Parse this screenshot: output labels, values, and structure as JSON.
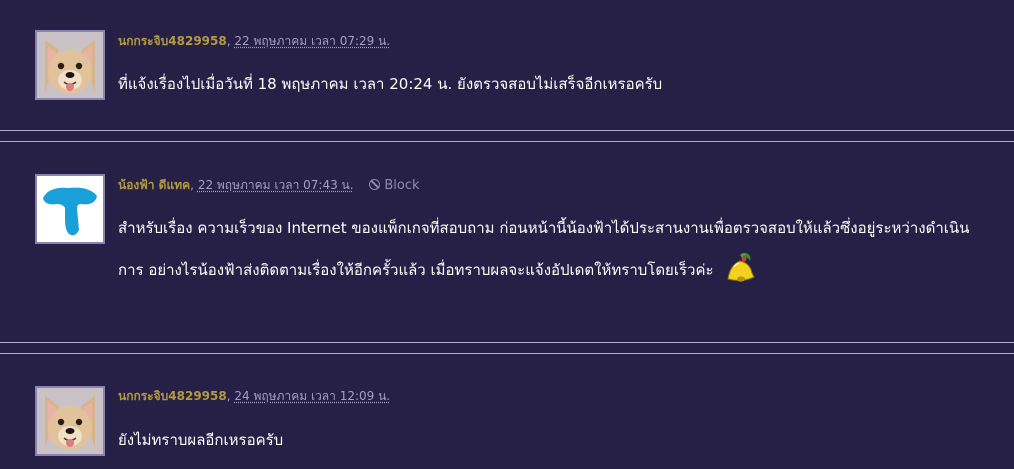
{
  "posts": [
    {
      "author": "นกกระจิบ4829958",
      "separator": ",",
      "date": "22 พฤษภาคม เวลา 07:29 น.",
      "avatar_icon": "french-bulldog-avatar",
      "body": "ที่แจ้งเรื่องไปเมื่อวันที่ 18 พฤษภาคม เวลา 20:24 น. ยังตรวจสอบไม่เสร็จอีกเหรอครับ"
    },
    {
      "author": "น้องฟ้า ดีแทค",
      "separator": ",",
      "date": "22 พฤษภาคม เวลา 07:43 น.",
      "block_label": "Block",
      "avatar_icon": "dtac-logo-avatar",
      "body_line1": "สำหรับเรื่อง ความเร็วของ Internet ของแพ็กเกจที่สอบถาม ก่อนหน้านี้น้องฟ้าได้ประสานงานเพื่อตรวจสอบให้แล้วซึ่งอยู่ระหว่างดำเนิน",
      "body_line2": "การ  อย่างไรน้องฟ้าส่งติดตามเรื่องให้อีกครั้วแล้ว เมื่อทราบผลจะแจ้งอัปเดตให้ทราบโดยเร็วค่ะ",
      "emoji_icon": "bell-icon"
    },
    {
      "author": "นกกระจิบ4829958",
      "separator": ",",
      "date": "24 พฤษภาคม เวลา 12:09 น.",
      "avatar_icon": "french-bulldog-avatar",
      "body": "ยังไม่ทราบผลอีกเหรอครับ"
    }
  ],
  "colors": {
    "background": "#272046",
    "author": "#b39a3e",
    "meta": "#a49ec2",
    "divider": "#b3acd0",
    "body_text": "#ffffff"
  }
}
